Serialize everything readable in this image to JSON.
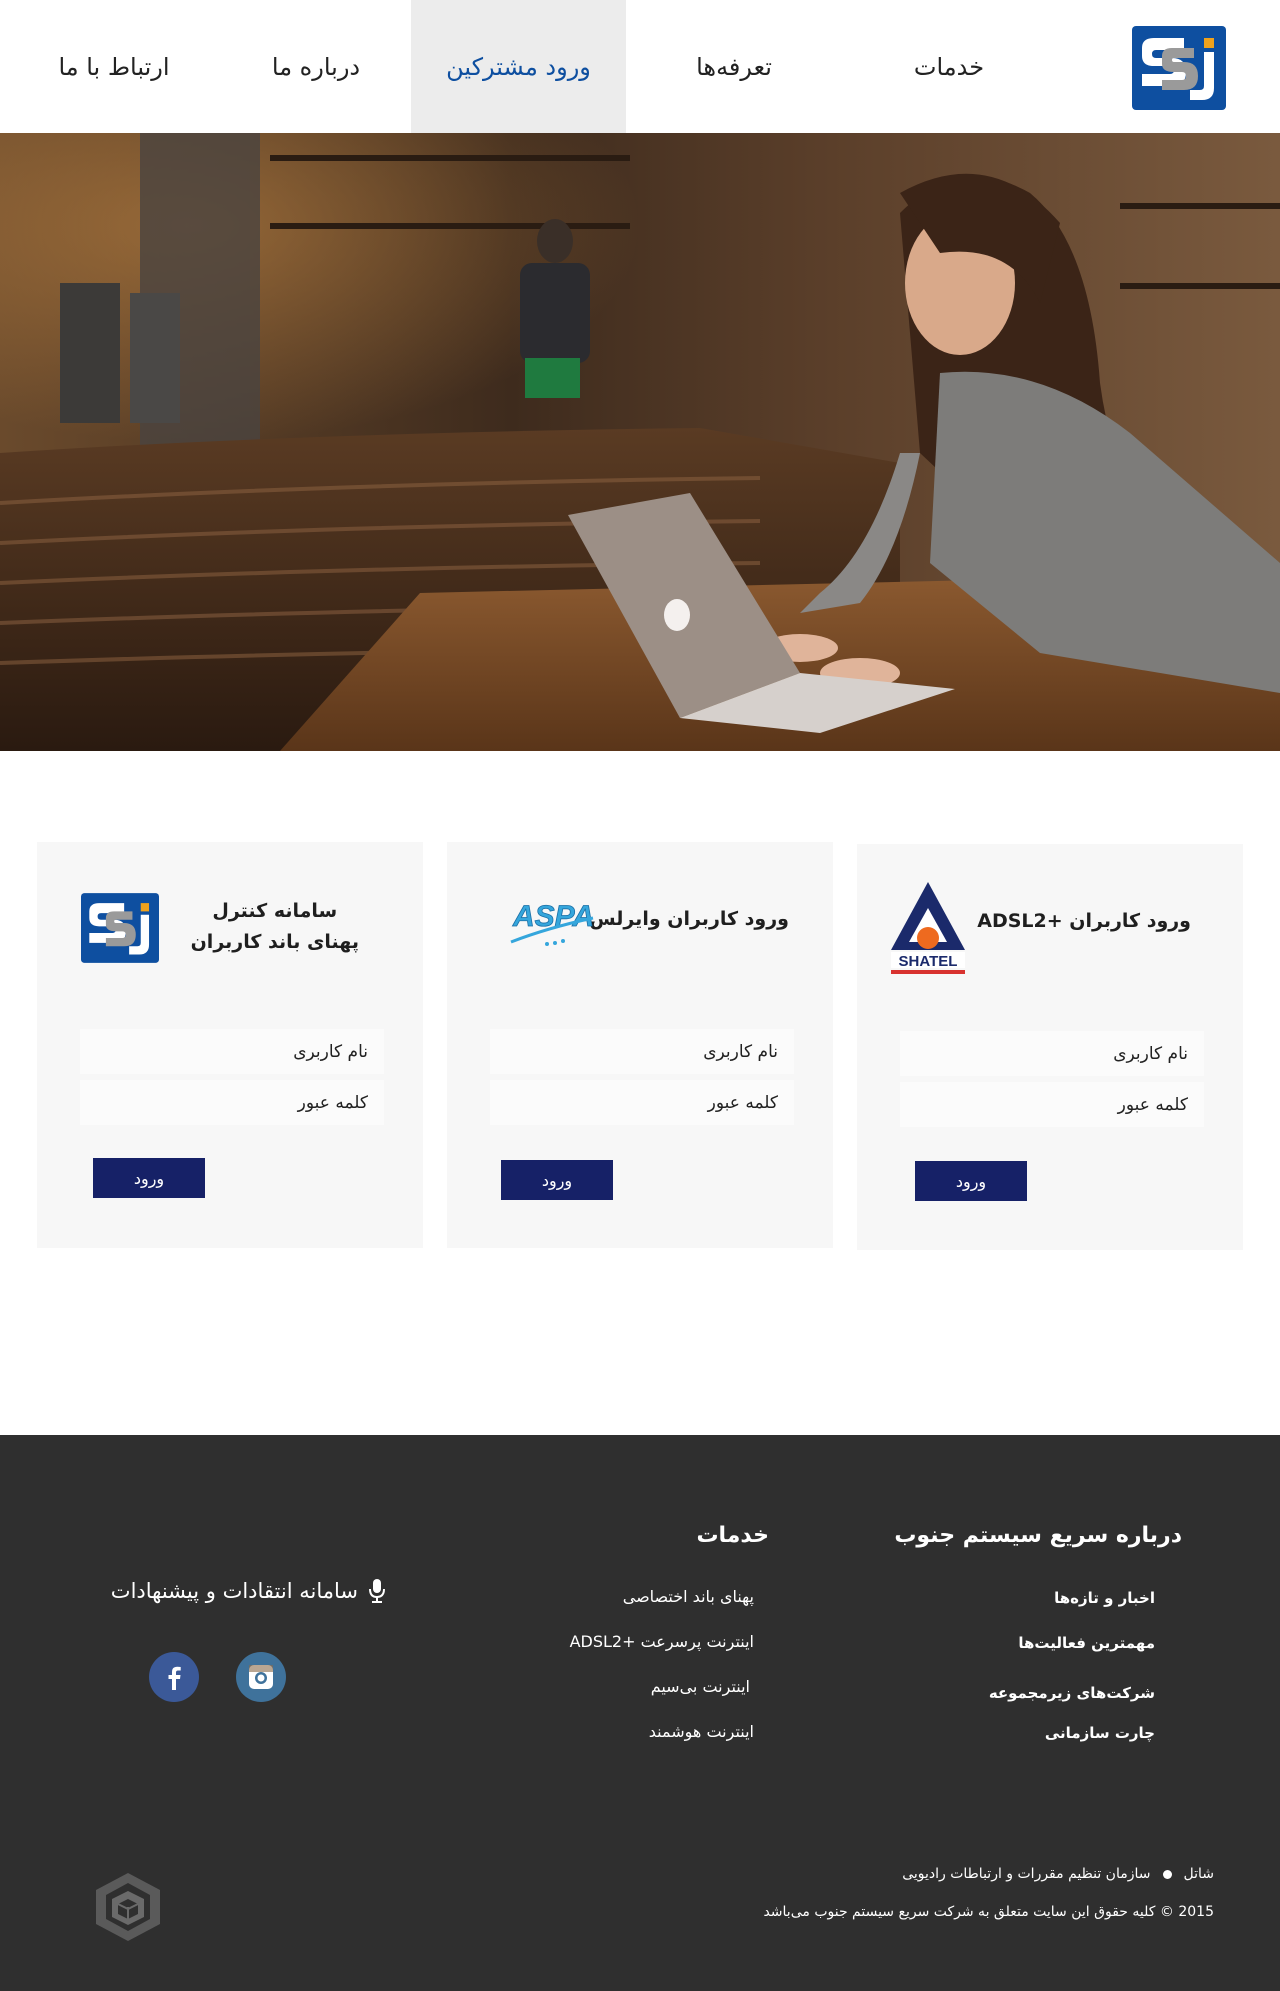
{
  "header": {
    "logo_text": "SSJ",
    "nav": [
      {
        "label": "خدمات"
      },
      {
        "label": "تعرفه‌ها"
      },
      {
        "label": "ورود مشترکین",
        "active": true
      },
      {
        "label": "درباره ما"
      },
      {
        "label": "ارتباط با ما"
      }
    ]
  },
  "hero": {
    "image_subject": "woman working on laptop in cafe"
  },
  "cards": [
    {
      "title": "ورود کاربران +ADSL2",
      "logo": "shatel-logo",
      "logo_text": "SHATEL",
      "username_placeholder": "نام کاربری",
      "password_placeholder": "کلمه عبور",
      "button_label": "ورود"
    },
    {
      "title": "ورود کاربران وایرلس",
      "logo": "aspa-logo",
      "logo_text": "ASPA",
      "username_placeholder": "نام کاربری",
      "password_placeholder": "کلمه عبور",
      "button_label": "ورود"
    },
    {
      "title_line1": "سامانه کنترل",
      "title_line2": "پهنای باند کاربران",
      "logo": "ssj-logo",
      "logo_text": "SSJ",
      "username_placeholder": "نام کاربری",
      "password_placeholder": "کلمه عبور",
      "button_label": "ورود"
    }
  ],
  "footer": {
    "about": {
      "heading": "درباره سریع سیستم جنوب",
      "links": [
        "اخبار و تازه‌ها",
        "مهمترین فعالیت‌ها",
        "شرکت‌های زیرمجموعه",
        "چارت سازمانی"
      ]
    },
    "services": {
      "heading": "خدمات",
      "links": [
        "پهنای باند اختصاصی",
        "اینترنت پرسرعت +ADSL2",
        "اینترنت بی‌سیم",
        "اینترنت هوشمند"
      ]
    },
    "feedback_label": "سامانه انتقادات و پیشنهادات",
    "social": [
      {
        "name": "instagram-icon",
        "color": "#3f729b"
      },
      {
        "name": "facebook-icon",
        "color": "#3b5998"
      }
    ],
    "partners": {
      "a": "شاتل",
      "b": "سازمان تنظیم مقررات و ارتباطات رادیویی"
    },
    "copyright": "2015 ©  کلیه حقوق این سایت متعلق به شرکت سریع سیستم جنوب می‌باشد"
  },
  "colors": {
    "brand_blue": "#0e4fa0",
    "button_navy": "#162167",
    "footer_bg": "#2f2f2f",
    "active_nav_bg": "#ececec"
  }
}
